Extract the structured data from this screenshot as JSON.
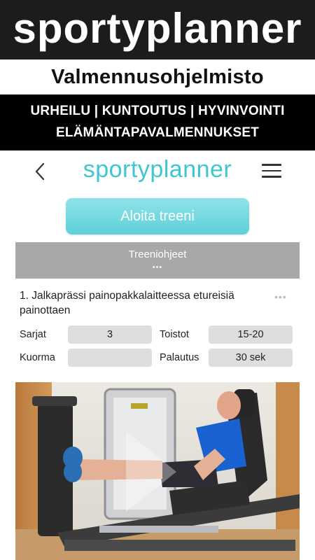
{
  "banner": {
    "brand": "sportyplanner",
    "subtitle": "Valmennusohjelmisto",
    "categories_line1": "URHEILU | KUNTOUTUS  | HYVINVOINTI",
    "categories_line2": "ELÄMÄNTAPAVALMENNUKSET"
  },
  "app": {
    "logo": "sportyplanner",
    "start_button": "Aloita treeni",
    "instructions_title": "Treeniohjeet",
    "instructions_dots": "•••",
    "exercise": {
      "title": "1. Jalkaprässi painopakkalaitteessa etureisiä painottaen",
      "more": "•••",
      "fields": {
        "sets_label": "Sarjat",
        "sets_value": "3",
        "reps_label": "Toistot",
        "reps_value": "15-20",
        "load_label": "Kuorma",
        "load_value": "",
        "rest_label": "Palautus",
        "rest_value": "30 sek"
      }
    }
  },
  "icons": {
    "back": "chevron-left-icon",
    "menu": "hamburger-menu-icon",
    "play": "play-icon"
  },
  "colors": {
    "brand_teal": "#3fc7cf",
    "button_teal": "#6dd6dd",
    "banner_black": "#1c1c1c",
    "instructions_gray": "#a8a8a8"
  }
}
